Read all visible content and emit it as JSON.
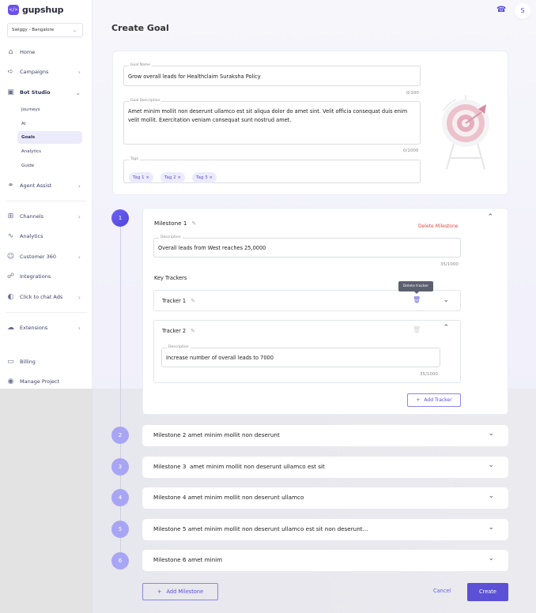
{
  "app": {
    "brand": "gupshup",
    "brand_mark": "</>"
  },
  "sidebar": {
    "workspace": "Swiggy - Bangalore",
    "items": [
      {
        "label": "Home",
        "icon": "home-icon",
        "has_arrow": false
      },
      {
        "label": "Campaigns",
        "icon": "megaphone-icon",
        "has_arrow": true
      },
      {
        "label": "Bot Studio",
        "icon": "bot-icon",
        "has_arrow": true,
        "expanded": true
      },
      {
        "label": "Agent Assist",
        "icon": "headset-icon",
        "has_arrow": true
      },
      {
        "label": "Channels",
        "icon": "channels-icon",
        "has_arrow": true
      },
      {
        "label": "Analytics",
        "icon": "chart-icon",
        "has_arrow": false
      },
      {
        "label": "Customer 360",
        "icon": "users-icon",
        "has_arrow": true
      },
      {
        "label": "Integrations",
        "icon": "plug-icon",
        "has_arrow": false
      },
      {
        "label": "Click to chat Ads",
        "icon": "ads-icon",
        "has_arrow": true
      },
      {
        "label": "Extensions",
        "icon": "puzzle-icon",
        "has_arrow": true
      },
      {
        "label": "Billing",
        "icon": "wallet-icon",
        "has_arrow": false
      },
      {
        "label": "Manage Project",
        "icon": "shield-user-icon",
        "has_arrow": false
      }
    ],
    "bot_studio_sub": [
      {
        "label": "Journeys",
        "active": false
      },
      {
        "label": "AI",
        "active": false
      },
      {
        "label": "Goals",
        "active": true
      },
      {
        "label": "Analytics",
        "active": false
      },
      {
        "label": "Guide",
        "active": false
      }
    ]
  },
  "topbar": {
    "avatar_initial": "S"
  },
  "page": {
    "title": "Create Goal"
  },
  "goal": {
    "name_label": "Goal Name",
    "name_value": "Grow overall leads for Healthclaim Suraksha Policy",
    "name_counter": "0/100",
    "desc_label": "Goal Description",
    "desc_value": "Amet minim mollit non deserunt ullamco est sit aliqua dolor do amet sint. Velit officia consequat duis enim velit mollit. Exercitation veniam consequat sunt nostrud amet.",
    "desc_counter": "0/1000",
    "tags_label": "Tags",
    "tags": [
      "Tag 1",
      "Tag 2",
      "Tag 3"
    ]
  },
  "milestones": [
    {
      "number": "1",
      "title": "Milestone 1",
      "expanded": true,
      "delete_label": "Delete Milestone",
      "desc_label": "Description",
      "desc_value": "Overall leads from West reaches 25,0000",
      "desc_counter": "35/1000",
      "key_trackers_label": "Key Trackers",
      "trackers": [
        {
          "title": "Tracker 1",
          "expanded": false,
          "tooltip": "Delete tracker"
        },
        {
          "title": "Tracker 2",
          "expanded": true,
          "desc_label": "Description",
          "desc_value": "Increase number of overall leads to 7000",
          "desc_counter": "35/1000"
        }
      ],
      "add_tracker_label": "Add Tracker"
    },
    {
      "number": "2",
      "title": "Milestone 2 amet minim mollit non deserunt"
    },
    {
      "number": "3",
      "title": "Milestone 3  amet minim mollit non deserunt ullamco est sit"
    },
    {
      "number": "4",
      "title": "Milestone 4 amet minim mollit non deserunt ullamco"
    },
    {
      "number": "5",
      "title": "Milestone 5 amet minim mollit non deserunt ullamco est sit non deserunt..."
    },
    {
      "number": "6",
      "title": "Milestone 6 amet minim"
    }
  ],
  "footer": {
    "add_milestone_label": "Add Milestone",
    "cancel_label": "Cancel",
    "create_label": "Create"
  },
  "colors": {
    "accent": "#5b50d6",
    "danger": "#e04a4a",
    "step_inactive": "#a9a5f5"
  }
}
